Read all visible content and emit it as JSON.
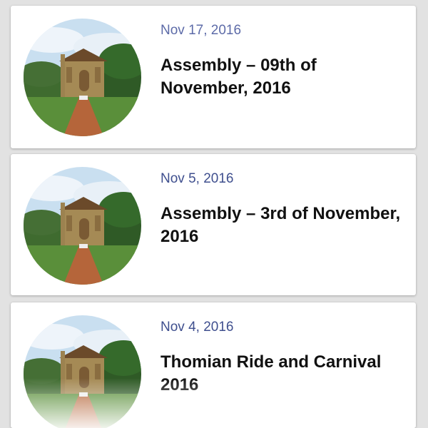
{
  "posts": [
    {
      "date": "Nov 17, 2016",
      "title": "Assembly – 09th of November, 2016"
    },
    {
      "date": "Nov 5, 2016",
      "title": "Assembly – 3rd of November, 2016"
    },
    {
      "date": "Nov 4, 2016",
      "title": "Thomian Ride and Carnival 2016"
    }
  ],
  "colors": {
    "background": "#e2e2e2",
    "card": "#ffffff",
    "date": "#3f4f8e",
    "title": "#111111"
  }
}
